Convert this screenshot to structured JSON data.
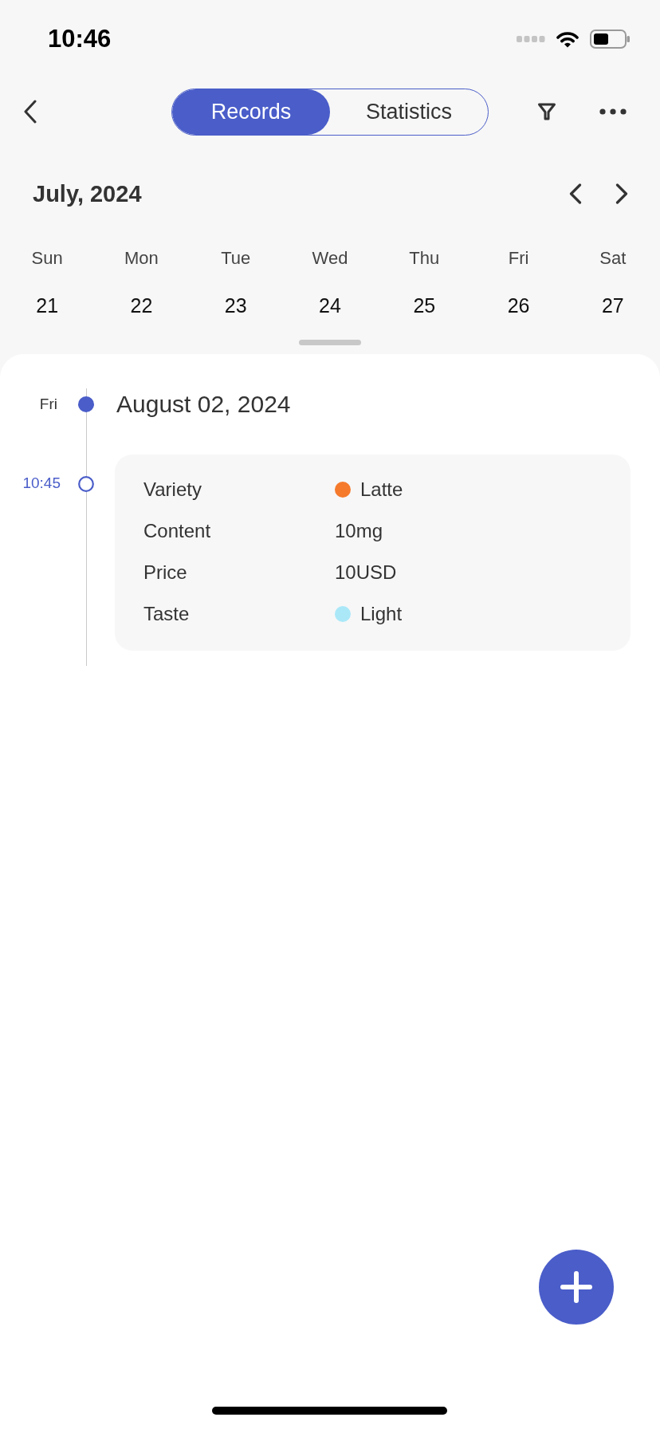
{
  "status_bar": {
    "time": "10:46"
  },
  "nav": {
    "tabs": [
      {
        "label": "Records",
        "selected": true
      },
      {
        "label": "Statistics",
        "selected": false
      }
    ]
  },
  "calendar": {
    "month": "July, 2024",
    "days": [
      {
        "weekday": "Sun",
        "date": "21"
      },
      {
        "weekday": "Mon",
        "date": "22"
      },
      {
        "weekday": "Tue",
        "date": "23"
      },
      {
        "weekday": "Wed",
        "date": "24"
      },
      {
        "weekday": "Thu",
        "date": "25"
      },
      {
        "weekday": "Fri",
        "date": "26"
      },
      {
        "weekday": "Sat",
        "date": "27"
      }
    ]
  },
  "timeline": {
    "days": [
      {
        "weekday": "Fri",
        "date": "August 02, 2024",
        "entries": [
          {
            "time": "10:45",
            "fields": [
              {
                "label": "Variety",
                "value": "Latte",
                "color": "#f57a2c"
              },
              {
                "label": "Content",
                "value": "10mg"
              },
              {
                "label": "Price",
                "value": "10USD"
              },
              {
                "label": "Taste",
                "value": "Light",
                "color": "#aae8f8"
              }
            ]
          }
        ]
      }
    ]
  }
}
